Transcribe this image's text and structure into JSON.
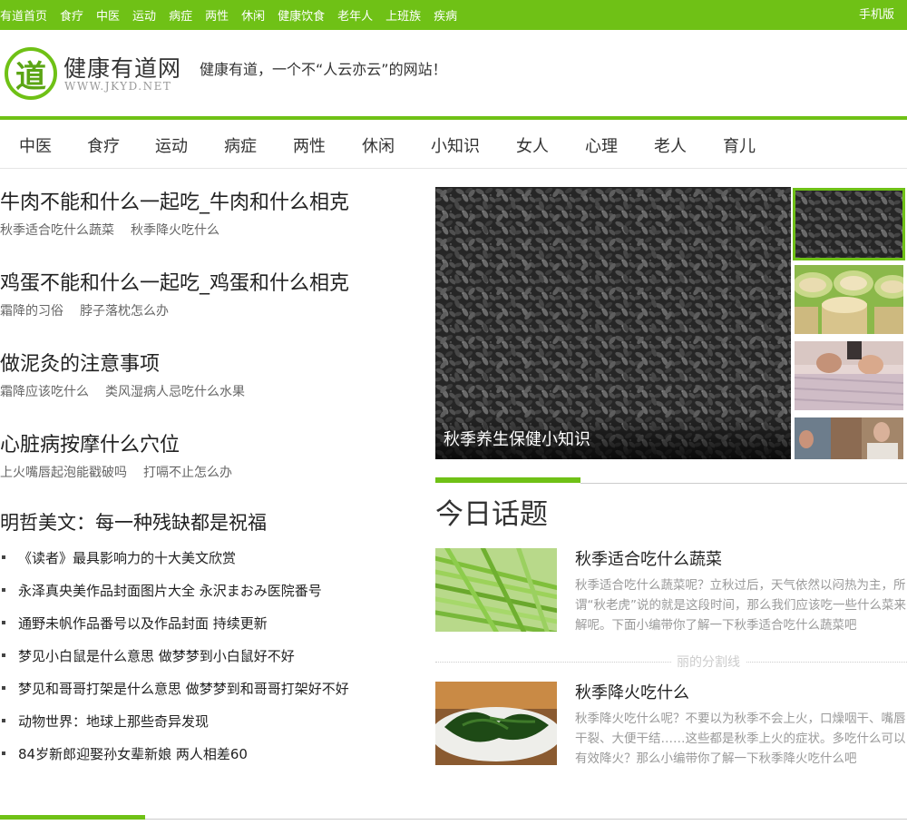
{
  "topnav": {
    "items": [
      "有道首页",
      "食疗",
      "中医",
      "运动",
      "病症",
      "两性",
      "休闲",
      "健康饮食",
      "老年人",
      "上班族",
      "疾病"
    ],
    "mobile": "手机版"
  },
  "header": {
    "logo_char": "道",
    "site_name": "健康有道网",
    "site_url": "WWW.JKYD.NET",
    "slogan": "健康有道，一个不“人云亦云”的网站！"
  },
  "mainnav": {
    "items": [
      "中医",
      "食疗",
      "运动",
      "病症",
      "两性",
      "休闲",
      "小知识",
      "女人",
      "心理",
      "老人",
      "育儿"
    ]
  },
  "headlines": [
    {
      "title": "牛肉不能和什么一起吃_牛肉和什么相克",
      "subs": [
        "秋季适合吃什么蔬菜",
        "秋季降火吃什么"
      ]
    },
    {
      "title": "鸡蛋不能和什么一起吃_鸡蛋和什么相克",
      "subs": [
        "霜降的习俗",
        "脖子落枕怎么办"
      ]
    },
    {
      "title": "做泥灸的注意事项",
      "subs": [
        "霜降应该吃什么",
        "类风湿病人忌吃什么水果"
      ]
    },
    {
      "title": "心脏病按摩什么穴位",
      "subs": [
        "上火嘴唇起泡能戳破吗",
        "打嗝不止怎么办"
      ]
    }
  ],
  "essay": {
    "title": "明哲美文：每一种残缺都是祝福",
    "items": [
      "《读者》最具影响力的十大美文欣赏",
      "永泽真央美作品封面图片大全 永沢まおみ医院番号",
      "通野未帆作品番号以及作品封面 持续更新",
      "梦见小白鼠是什么意思 做梦梦到小白鼠好不好",
      "梦见和哥哥打架是什么意思 做梦梦到和哥哥打架好不好",
      "动物世界：地球上那些奇异发现",
      "84岁新郎迎娶孙女辈新娘 两人相差60"
    ]
  },
  "feature": {
    "caption": "秋季养生保健小知识"
  },
  "today": {
    "heading": "今日话题",
    "divider_text": "丽的分割线",
    "articles": [
      {
        "title": "秋季适合吃什么蔬菜",
        "desc": "秋季适合吃什么蔬菜呢？立秋过后，天气依然以闷热为主，所谓“秋老虎”说的就是这段时间，那么我们应该吃一些什么菜来解呢。下面小编带你了解一下秋季适合吃什么蔬菜吧"
      },
      {
        "title": "秋季降火吃什么",
        "desc": "秋季降火吃什么呢？不要以为秋季不会上火，口燥咽干、嘴唇干裂、大便干结……这些都是秋季上火的症状。多吃什么可以有效降火？那么小编带你了解一下秋季降火吃什么吧"
      }
    ]
  },
  "colors": {
    "brand_green": "#6fc116",
    "text": "#333333",
    "muted": "#999999"
  }
}
